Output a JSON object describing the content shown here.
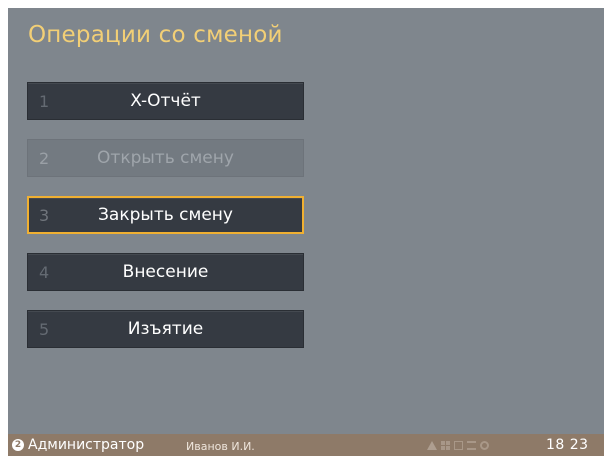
{
  "screen": {
    "title": "Операции со сменой"
  },
  "menu": {
    "items": [
      {
        "number": "1",
        "label": "X-Отчёт",
        "state": "normal"
      },
      {
        "number": "2",
        "label": "Открыть смену",
        "state": "disabled"
      },
      {
        "number": "3",
        "label": "Закрыть смену",
        "state": "selected"
      },
      {
        "number": "4",
        "label": "Внесение",
        "state": "normal"
      },
      {
        "number": "5",
        "label": "Изъятие",
        "state": "normal"
      }
    ]
  },
  "status_bar": {
    "user_badge": "2",
    "role": "Администратор",
    "user_name": "Иванов И.И.",
    "icons": [
      "warning-icon",
      "grid-icon",
      "document-icon",
      "network-icon",
      "sync-icon"
    ],
    "time": "18 23"
  },
  "colors": {
    "background": "#7f868d",
    "title": "#f2cf76",
    "button": "#353a42",
    "selected_border": "#f0b032",
    "status_bar": "#8e7a68"
  }
}
